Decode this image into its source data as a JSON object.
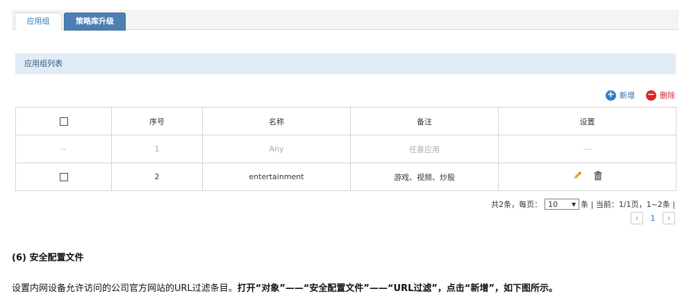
{
  "tabs": [
    {
      "label": "应用组",
      "active": true
    },
    {
      "label": "策略库升级",
      "active": false
    }
  ],
  "section": {
    "title": "应用组列表"
  },
  "actions": {
    "add_label": "新增",
    "delete_label": "删除"
  },
  "table": {
    "headers": [
      "",
      "序号",
      "名称",
      "备注",
      "设置"
    ],
    "rows": [
      {
        "check": "--",
        "index": "1",
        "name": "Any",
        "remark": "任意应用",
        "settings": "---",
        "disabled": true
      },
      {
        "check": "",
        "index": "2",
        "name": "entertainment",
        "remark": "游戏、视频、炒股",
        "settings": "",
        "disabled": false
      }
    ]
  },
  "pagination": {
    "prefix": "共2条，每页：",
    "per_page": "10",
    "suffix": "条 | 当前：1/1页，1~2条 |",
    "current_page": "1"
  },
  "doc": {
    "heading": "(6) 安全配置文件",
    "para_plain": "设置内网设备允许访问的公司官方网站的URL过滤条目。",
    "para_bold": "打开“对象”——“安全配置文件”——“URL过滤”，点击“新增”，如下图所示。"
  },
  "colors": {
    "accent": "#2f7ec7",
    "danger": "#d8282a",
    "tab_inactive": "#4d7fb3",
    "header_bg": "#e1ebf4"
  }
}
